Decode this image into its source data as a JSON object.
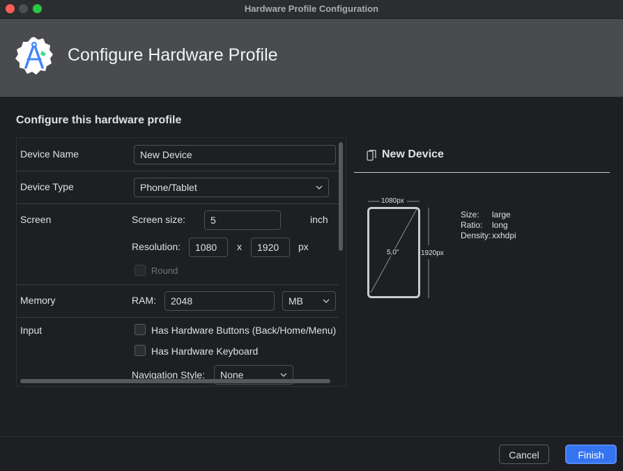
{
  "window": {
    "title": "Hardware Profile Configuration"
  },
  "header": {
    "title": "Configure Hardware Profile",
    "logo_icon": "android-studio-logo-icon"
  },
  "section_title": "Configure this hardware profile",
  "form": {
    "device_name": {
      "label": "Device Name",
      "value": "New Device"
    },
    "device_type": {
      "label": "Device Type",
      "value": "Phone/Tablet"
    },
    "screen": {
      "label": "Screen",
      "size_label": "Screen size:",
      "size_value": "5",
      "size_unit": "inch",
      "resolution_label": "Resolution:",
      "res_x": "1080",
      "res_sep": "x",
      "res_y": "1920",
      "res_unit": "px",
      "round_label": "Round"
    },
    "memory": {
      "label": "Memory",
      "ram_label": "RAM:",
      "ram_value": "2048",
      "ram_unit": "MB"
    },
    "input": {
      "label": "Input",
      "hw_buttons_label": "Has Hardware Buttons (Back/Home/Menu)",
      "hw_keyboard_label": "Has Hardware Keyboard",
      "nav_style_label": "Navigation Style:",
      "nav_style_value": "None"
    }
  },
  "preview": {
    "name": "New Device",
    "width_label": "1080px",
    "height_label": "1920px",
    "diagonal_label": "5,0\"",
    "specs": [
      {
        "label": "Size:",
        "value": "large"
      },
      {
        "label": "Ratio:",
        "value": "long"
      },
      {
        "label": "Density:",
        "value": "xxhdpi"
      }
    ]
  },
  "buttons": {
    "cancel": "Cancel",
    "finish": "Finish"
  },
  "colors": {
    "accent": "#3574f0",
    "header_bg": "#4a4b4e",
    "window_bg": "#1e1f22"
  }
}
